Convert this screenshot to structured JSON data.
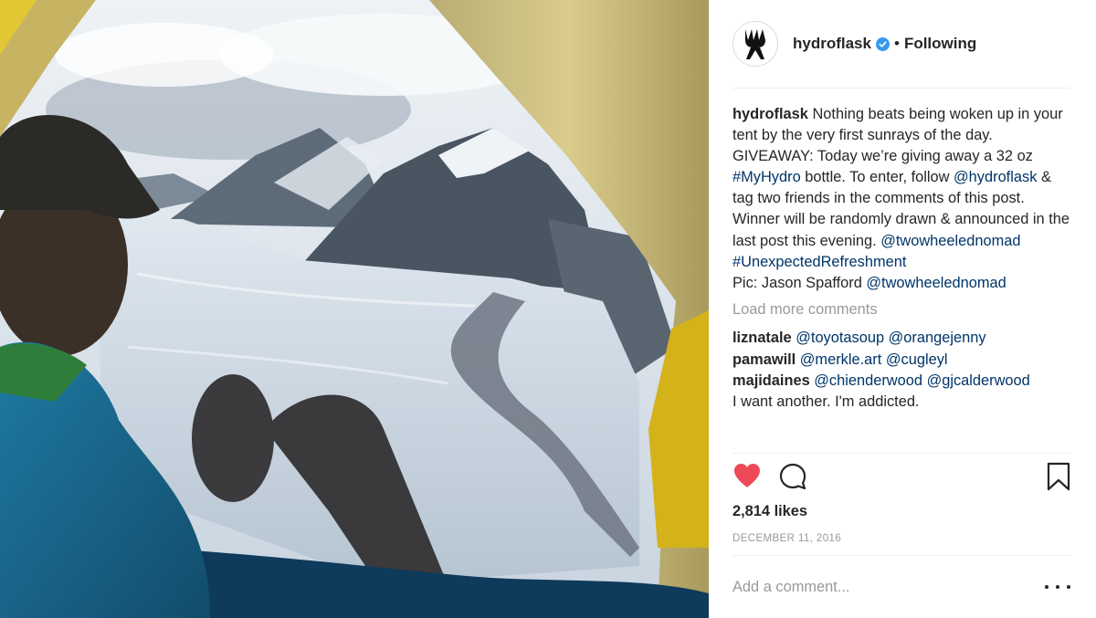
{
  "post": {
    "photo_alt": "",
    "header": {
      "username": "hydroflask",
      "separator": "•",
      "follow_status": "Following",
      "avatar_icon": "hydroflask-logo-icon",
      "verified_icon": "verified-badge-icon"
    },
    "caption": {
      "username": "hydroflask",
      "text_1": " Nothing beats being woken up in your tent by the very first sunrays of the day. GIVEAWAY: Today we’re giving away a 32 oz ",
      "hashtag_1": "#MyHydro",
      "text_2": " bottle. To enter, follow ",
      "mention_1": "@hydroflask",
      "text_3": " & tag two friends in the comments of this post. Winner will be randomly drawn & announced in the last post this evening. ",
      "mention_2": "@twowheelednomad",
      "hashtag_2": "#UnexpectedRefreshment",
      "text_4": "Pic: Jason Spafford ",
      "mention_3": "@twowheelednomad"
    },
    "load_more_label": "Load more comments",
    "comments": [
      {
        "username": "liznatale",
        "mention_a": "@toyotasoup",
        "mention_b": "@orangejenny"
      },
      {
        "username": "pamawill",
        "mention_a": "@merkle.art",
        "mention_b": "@cugleyl"
      },
      {
        "username": "majidaines",
        "mention_a": "@chienderwood",
        "mention_b": "@gjcalderwood",
        "text": "I want another. I'm addicted."
      }
    ],
    "actions": {
      "like_icon": "heart-filled-icon",
      "comment_icon": "comment-bubble-icon",
      "save_icon": "bookmark-icon",
      "like_color": "#ed4956"
    },
    "likes_label": "2,814 likes",
    "date": "DECEMBER 11, 2016",
    "comment_placeholder": "Add a comment...",
    "more_icon": "more-options-icon"
  },
  "colors": {
    "text": "#262626",
    "link": "#003569",
    "muted": "#999999",
    "divider": "#efefef",
    "verified": "#3897f0"
  }
}
